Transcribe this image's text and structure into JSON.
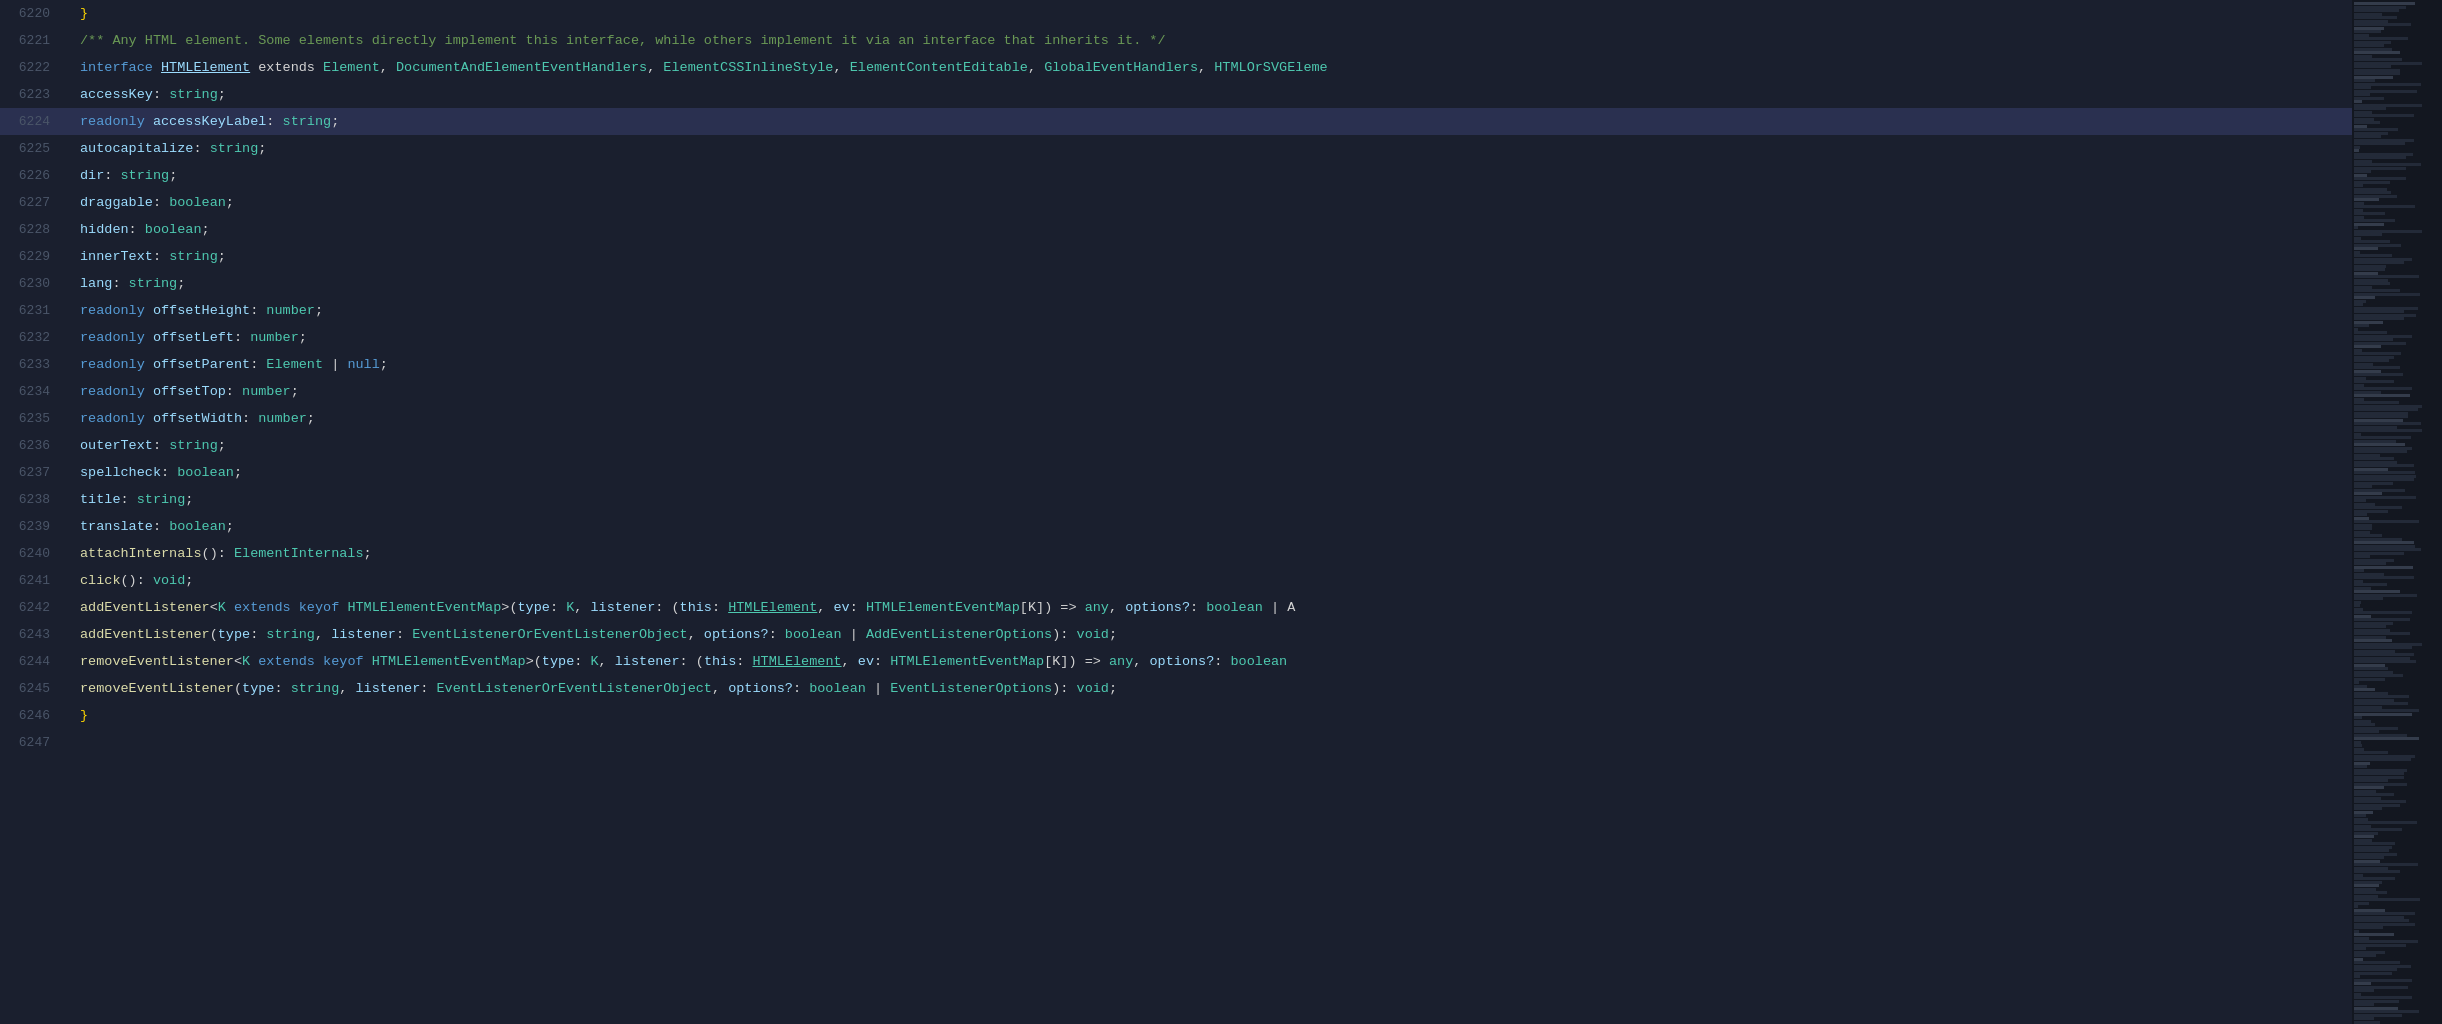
{
  "editor": {
    "background": "#1a1f2e",
    "highlighted_line": 6224,
    "lines": [
      {
        "num": 6220,
        "tokens": [
          {
            "t": "}",
            "c": "c-brace"
          }
        ]
      },
      {
        "num": 6221,
        "tokens": [
          {
            "t": "/** Any HTML element. Some elements directly implement this interface, while others implement it via an interface that inherits it. */",
            "c": "c-comment"
          }
        ]
      },
      {
        "num": 6222,
        "tokens": [
          {
            "t": "interface ",
            "c": "c-keyword"
          },
          {
            "t": "HTMLElement",
            "c": "c-link"
          },
          {
            "t": " extends ",
            "c": "c-text"
          },
          {
            "t": "Element",
            "c": "c-type"
          },
          {
            "t": ", ",
            "c": "c-text"
          },
          {
            "t": "DocumentAndElementEventHandlers",
            "c": "c-type"
          },
          {
            "t": ", ",
            "c": "c-text"
          },
          {
            "t": "ElementCSSInlineStyle",
            "c": "c-type"
          },
          {
            "t": ", ",
            "c": "c-text"
          },
          {
            "t": "ElementContentEditable",
            "c": "c-type"
          },
          {
            "t": ", ",
            "c": "c-text"
          },
          {
            "t": "GlobalEventHandlers",
            "c": "c-type"
          },
          {
            "t": ", ",
            "c": "c-text"
          },
          {
            "t": "HTMLOrSVGEleme",
            "c": "c-type"
          }
        ]
      },
      {
        "num": 6223,
        "tokens": [
          {
            "t": "    ",
            "c": "c-text"
          },
          {
            "t": "accessKey",
            "c": "c-property"
          },
          {
            "t": ": ",
            "c": "c-text"
          },
          {
            "t": "string",
            "c": "c-string-type"
          },
          {
            "t": ";",
            "c": "c-text"
          }
        ]
      },
      {
        "num": 6224,
        "tokens": [
          {
            "t": "    ",
            "c": "c-text"
          },
          {
            "t": "readonly ",
            "c": "c-readonly"
          },
          {
            "t": "accessKeyLabel",
            "c": "c-property"
          },
          {
            "t": ": ",
            "c": "c-text"
          },
          {
            "t": "string",
            "c": "c-string-type"
          },
          {
            "t": ";",
            "c": "c-text"
          }
        ],
        "highlighted": true
      },
      {
        "num": 6225,
        "tokens": [
          {
            "t": "    ",
            "c": "c-text"
          },
          {
            "t": "autocapitalize",
            "c": "c-property"
          },
          {
            "t": ": ",
            "c": "c-text"
          },
          {
            "t": "string",
            "c": "c-string-type"
          },
          {
            "t": ";",
            "c": "c-text"
          }
        ]
      },
      {
        "num": 6226,
        "tokens": [
          {
            "t": "    ",
            "c": "c-text"
          },
          {
            "t": "dir",
            "c": "c-property"
          },
          {
            "t": ": ",
            "c": "c-text"
          },
          {
            "t": "string",
            "c": "c-string-type"
          },
          {
            "t": ";",
            "c": "c-text"
          }
        ]
      },
      {
        "num": 6227,
        "tokens": [
          {
            "t": "    ",
            "c": "c-text"
          },
          {
            "t": "draggable",
            "c": "c-property"
          },
          {
            "t": ": ",
            "c": "c-text"
          },
          {
            "t": "boolean",
            "c": "c-boolean-type"
          },
          {
            "t": ";",
            "c": "c-text"
          }
        ]
      },
      {
        "num": 6228,
        "tokens": [
          {
            "t": "    ",
            "c": "c-text"
          },
          {
            "t": "hidden",
            "c": "c-property"
          },
          {
            "t": ": ",
            "c": "c-text"
          },
          {
            "t": "boolean",
            "c": "c-boolean-type"
          },
          {
            "t": ";",
            "c": "c-text"
          }
        ]
      },
      {
        "num": 6229,
        "tokens": [
          {
            "t": "    ",
            "c": "c-text"
          },
          {
            "t": "innerText",
            "c": "c-property"
          },
          {
            "t": ": ",
            "c": "c-text"
          },
          {
            "t": "string",
            "c": "c-string-type"
          },
          {
            "t": ";",
            "c": "c-text"
          }
        ]
      },
      {
        "num": 6230,
        "tokens": [
          {
            "t": "    ",
            "c": "c-text"
          },
          {
            "t": "lang",
            "c": "c-property"
          },
          {
            "t": ": ",
            "c": "c-text"
          },
          {
            "t": "string",
            "c": "c-string-type"
          },
          {
            "t": ";",
            "c": "c-text"
          }
        ]
      },
      {
        "num": 6231,
        "tokens": [
          {
            "t": "    ",
            "c": "c-text"
          },
          {
            "t": "readonly ",
            "c": "c-readonly"
          },
          {
            "t": "offsetHeight",
            "c": "c-property"
          },
          {
            "t": ": ",
            "c": "c-text"
          },
          {
            "t": "number",
            "c": "c-number-type"
          },
          {
            "t": ";",
            "c": "c-text"
          }
        ]
      },
      {
        "num": 6232,
        "tokens": [
          {
            "t": "    ",
            "c": "c-text"
          },
          {
            "t": "readonly ",
            "c": "c-readonly"
          },
          {
            "t": "offsetLeft",
            "c": "c-property"
          },
          {
            "t": ": ",
            "c": "c-text"
          },
          {
            "t": "number",
            "c": "c-number-type"
          },
          {
            "t": ";",
            "c": "c-text"
          }
        ]
      },
      {
        "num": 6233,
        "tokens": [
          {
            "t": "    ",
            "c": "c-text"
          },
          {
            "t": "readonly ",
            "c": "c-readonly"
          },
          {
            "t": "offsetParent",
            "c": "c-property"
          },
          {
            "t": ": ",
            "c": "c-text"
          },
          {
            "t": "Element",
            "c": "c-type"
          },
          {
            "t": " | ",
            "c": "c-text"
          },
          {
            "t": "null",
            "c": "c-null"
          },
          {
            "t": ";",
            "c": "c-text"
          }
        ]
      },
      {
        "num": 6234,
        "tokens": [
          {
            "t": "    ",
            "c": "c-text"
          },
          {
            "t": "readonly ",
            "c": "c-readonly"
          },
          {
            "t": "offsetTop",
            "c": "c-property"
          },
          {
            "t": ": ",
            "c": "c-text"
          },
          {
            "t": "number",
            "c": "c-number-type"
          },
          {
            "t": ";",
            "c": "c-text"
          }
        ]
      },
      {
        "num": 6235,
        "tokens": [
          {
            "t": "    ",
            "c": "c-text"
          },
          {
            "t": "readonly ",
            "c": "c-readonly"
          },
          {
            "t": "offsetWidth",
            "c": "c-property"
          },
          {
            "t": ": ",
            "c": "c-text"
          },
          {
            "t": "number",
            "c": "c-number-type"
          },
          {
            "t": ";",
            "c": "c-text"
          }
        ]
      },
      {
        "num": 6236,
        "tokens": [
          {
            "t": "    ",
            "c": "c-text"
          },
          {
            "t": "outerText",
            "c": "c-property"
          },
          {
            "t": ": ",
            "c": "c-text"
          },
          {
            "t": "string",
            "c": "c-string-type"
          },
          {
            "t": ";",
            "c": "c-text"
          }
        ]
      },
      {
        "num": 6237,
        "tokens": [
          {
            "t": "    ",
            "c": "c-text"
          },
          {
            "t": "spellcheck",
            "c": "c-property"
          },
          {
            "t": ": ",
            "c": "c-text"
          },
          {
            "t": "boolean",
            "c": "c-boolean-type"
          },
          {
            "t": ";",
            "c": "c-text"
          }
        ]
      },
      {
        "num": 6238,
        "tokens": [
          {
            "t": "    ",
            "c": "c-text"
          },
          {
            "t": "title",
            "c": "c-property"
          },
          {
            "t": ": ",
            "c": "c-text"
          },
          {
            "t": "string",
            "c": "c-string-type"
          },
          {
            "t": ";",
            "c": "c-text"
          }
        ]
      },
      {
        "num": 6239,
        "tokens": [
          {
            "t": "    ",
            "c": "c-text"
          },
          {
            "t": "translate",
            "c": "c-property"
          },
          {
            "t": ": ",
            "c": "c-text"
          },
          {
            "t": "boolean",
            "c": "c-boolean-type"
          },
          {
            "t": ";",
            "c": "c-text"
          }
        ]
      },
      {
        "num": 6240,
        "tokens": [
          {
            "t": "    ",
            "c": "c-text"
          },
          {
            "t": "attachInternals",
            "c": "c-method"
          },
          {
            "t": "(): ",
            "c": "c-text"
          },
          {
            "t": "ElementInternals",
            "c": "c-type"
          },
          {
            "t": ";",
            "c": "c-text"
          }
        ]
      },
      {
        "num": 6241,
        "tokens": [
          {
            "t": "    ",
            "c": "c-text"
          },
          {
            "t": "click",
            "c": "c-method"
          },
          {
            "t": "(): ",
            "c": "c-text"
          },
          {
            "t": "void",
            "c": "c-void-type"
          },
          {
            "t": ";",
            "c": "c-text"
          }
        ]
      },
      {
        "num": 6242,
        "tokens": [
          {
            "t": "    ",
            "c": "c-text"
          },
          {
            "t": "addEventListener",
            "c": "c-method"
          },
          {
            "t": "<",
            "c": "c-text"
          },
          {
            "t": "K",
            "c": "c-generic"
          },
          {
            "t": " extends ",
            "c": "c-extends"
          },
          {
            "t": "keyof ",
            "c": "c-keyof"
          },
          {
            "t": "HTMLElementEventMap",
            "c": "c-type"
          },
          {
            "t": ">(",
            "c": "c-text"
          },
          {
            "t": "type",
            "c": "c-param"
          },
          {
            "t": ": ",
            "c": "c-text"
          },
          {
            "t": "K",
            "c": "c-generic"
          },
          {
            "t": ", ",
            "c": "c-text"
          },
          {
            "t": "listener",
            "c": "c-param"
          },
          {
            "t": ": (",
            "c": "c-text"
          },
          {
            "t": "this",
            "c": "c-param"
          },
          {
            "t": ": ",
            "c": "c-text"
          },
          {
            "t": "HTMLElement",
            "c": "c-HTMLElement-ref"
          },
          {
            "t": ", ",
            "c": "c-text"
          },
          {
            "t": "ev",
            "c": "c-param"
          },
          {
            "t": ": ",
            "c": "c-text"
          },
          {
            "t": "HTMLElementEventMap",
            "c": "c-type"
          },
          {
            "t": "[K]) => ",
            "c": "c-text"
          },
          {
            "t": "any",
            "c": "c-any"
          },
          {
            "t": ", ",
            "c": "c-text"
          },
          {
            "t": "options?",
            "c": "c-param"
          },
          {
            "t": ": ",
            "c": "c-text"
          },
          {
            "t": "boolean",
            "c": "c-boolean-type"
          },
          {
            "t": " | A",
            "c": "c-text"
          }
        ]
      },
      {
        "num": 6243,
        "tokens": [
          {
            "t": "    ",
            "c": "c-text"
          },
          {
            "t": "addEventListener",
            "c": "c-method"
          },
          {
            "t": "(",
            "c": "c-text"
          },
          {
            "t": "type",
            "c": "c-param"
          },
          {
            "t": ": ",
            "c": "c-text"
          },
          {
            "t": "string",
            "c": "c-string-type"
          },
          {
            "t": ", ",
            "c": "c-text"
          },
          {
            "t": "listener",
            "c": "c-param"
          },
          {
            "t": ": ",
            "c": "c-text"
          },
          {
            "t": "EventListenerOrEventListenerObject",
            "c": "c-type"
          },
          {
            "t": ", ",
            "c": "c-text"
          },
          {
            "t": "options?",
            "c": "c-param"
          },
          {
            "t": ": ",
            "c": "c-text"
          },
          {
            "t": "boolean",
            "c": "c-boolean-type"
          },
          {
            "t": " | ",
            "c": "c-text"
          },
          {
            "t": "AddEventListenerOptions",
            "c": "c-type"
          },
          {
            "t": "): ",
            "c": "c-text"
          },
          {
            "t": "void",
            "c": "c-void-type"
          },
          {
            "t": ";",
            "c": "c-text"
          }
        ]
      },
      {
        "num": 6244,
        "tokens": [
          {
            "t": "    ",
            "c": "c-text"
          },
          {
            "t": "removeEventListener",
            "c": "c-method"
          },
          {
            "t": "<",
            "c": "c-text"
          },
          {
            "t": "K",
            "c": "c-generic"
          },
          {
            "t": " extends ",
            "c": "c-extends"
          },
          {
            "t": "keyof ",
            "c": "c-keyof"
          },
          {
            "t": "HTMLElementEventMap",
            "c": "c-type"
          },
          {
            "t": ">(",
            "c": "c-text"
          },
          {
            "t": "type",
            "c": "c-param"
          },
          {
            "t": ": ",
            "c": "c-text"
          },
          {
            "t": "K",
            "c": "c-generic"
          },
          {
            "t": ", ",
            "c": "c-text"
          },
          {
            "t": "listener",
            "c": "c-param"
          },
          {
            "t": ": (",
            "c": "c-text"
          },
          {
            "t": "this",
            "c": "c-param"
          },
          {
            "t": ": ",
            "c": "c-text"
          },
          {
            "t": "HTMLElement",
            "c": "c-HTMLElement-ref"
          },
          {
            "t": ", ",
            "c": "c-text"
          },
          {
            "t": "ev",
            "c": "c-param"
          },
          {
            "t": ": ",
            "c": "c-text"
          },
          {
            "t": "HTMLElementEventMap",
            "c": "c-type"
          },
          {
            "t": "[K]) => ",
            "c": "c-text"
          },
          {
            "t": "any",
            "c": "c-any"
          },
          {
            "t": ", ",
            "c": "c-text"
          },
          {
            "t": "options?",
            "c": "c-param"
          },
          {
            "t": ": ",
            "c": "c-text"
          },
          {
            "t": "boolean",
            "c": "c-boolean-type"
          }
        ]
      },
      {
        "num": 6245,
        "tokens": [
          {
            "t": "    ",
            "c": "c-text"
          },
          {
            "t": "removeEventListener",
            "c": "c-method"
          },
          {
            "t": "(",
            "c": "c-text"
          },
          {
            "t": "type",
            "c": "c-param"
          },
          {
            "t": ": ",
            "c": "c-text"
          },
          {
            "t": "string",
            "c": "c-string-type"
          },
          {
            "t": ", ",
            "c": "c-text"
          },
          {
            "t": "listener",
            "c": "c-param"
          },
          {
            "t": ": ",
            "c": "c-text"
          },
          {
            "t": "EventListenerOrEventListenerObject",
            "c": "c-type"
          },
          {
            "t": ", ",
            "c": "c-text"
          },
          {
            "t": "options?",
            "c": "c-param"
          },
          {
            "t": ": ",
            "c": "c-text"
          },
          {
            "t": "boolean",
            "c": "c-boolean-type"
          },
          {
            "t": " | ",
            "c": "c-text"
          },
          {
            "t": "EventListenerOptions",
            "c": "c-type"
          },
          {
            "t": "): ",
            "c": "c-text"
          },
          {
            "t": "void",
            "c": "c-void-type"
          },
          {
            "t": ";",
            "c": "c-text"
          }
        ]
      },
      {
        "num": 6246,
        "tokens": [
          {
            "t": "}",
            "c": "c-brace"
          }
        ]
      },
      {
        "num": 6247,
        "tokens": []
      }
    ]
  }
}
